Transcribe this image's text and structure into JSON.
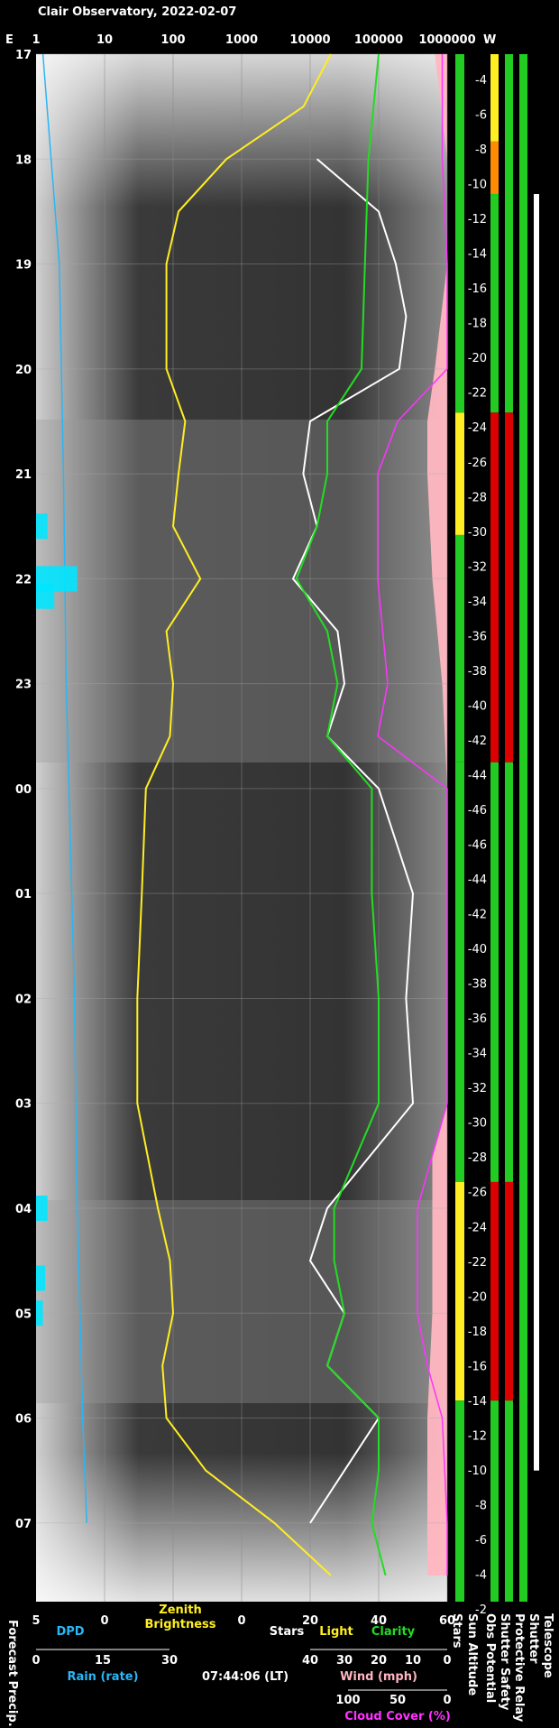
{
  "title": "Clair Observatory, 2022-02-07",
  "timestamp": "07:44:06 (LT)",
  "colors": {
    "dpd": "#29b6f6",
    "zenith": "#ffee22",
    "stars": "#ffffff",
    "light": "#ffee22",
    "clarity": "#22dd22",
    "wind": "#ffb6c1",
    "cloud": "#ff33ff",
    "rain": "#00e5ff",
    "sun": "#ffa500",
    "green": "#22cc22",
    "red": "#dd0000",
    "orange": "#ff8c00",
    "yellow": "#ffee22"
  },
  "top_axis": {
    "left_letter": "E",
    "right_letter": "W",
    "ticks": [
      "1",
      "10",
      "100",
      "1000",
      "10000",
      "100000",
      "1000000"
    ]
  },
  "hours": [
    "17",
    "18",
    "19",
    "20",
    "21",
    "22",
    "23",
    "00",
    "01",
    "02",
    "03",
    "04",
    "05",
    "06",
    "07"
  ],
  "sun_altitude_ticks": [
    "-4",
    "-6",
    "-8",
    "-10",
    "-12",
    "-14",
    "-16",
    "-18",
    "-20",
    "-22",
    "-24",
    "-26",
    "-28",
    "-30",
    "-32",
    "-34",
    "-36",
    "-38",
    "-40",
    "-42",
    "-44",
    "-46",
    "-46",
    "-44",
    "-42",
    "-40",
    "-38",
    "-36",
    "-34",
    "-32",
    "-30",
    "-28",
    "-26",
    "-24",
    "-22",
    "-20",
    "-18",
    "-16",
    "-14",
    "-12",
    "-10",
    "-8",
    "-6",
    "-4",
    "-2"
  ],
  "bottom": {
    "forecast_precip": "Forecast Precip.",
    "dpd_axis": {
      "label": "DPD",
      "ticks": [
        "5",
        "0"
      ]
    },
    "zenith_label_1": "Zenith",
    "zenith_label_2": "Brightness",
    "zenith_ticks": [
      "0"
    ],
    "stars_label": "Stars",
    "light_label": "Light",
    "clarity_label": "Clarity",
    "stars_ticks": [
      "20",
      "40",
      "60"
    ],
    "rain_axis": {
      "label": "Rain (rate)",
      "ticks": [
        "0",
        "15",
        "30"
      ]
    },
    "wind_axis": {
      "label": "Wind (mph)",
      "ticks": [
        "40",
        "30",
        "20",
        "10",
        "0"
      ]
    },
    "cloud_axis": {
      "label": "Cloud Cover (%)",
      "ticks": [
        "100",
        "50",
        "0"
      ]
    },
    "column_labels": [
      "Stars",
      "Sun Altitude",
      "Obs Potential",
      "Shutter Safety",
      "Protective Relay",
      "Shutter",
      "Telescope"
    ]
  },
  "chart_data": {
    "type": "line",
    "title": "Clair Observatory, 2022-02-07",
    "time_range": [
      "17:00",
      "07:45"
    ],
    "x_scale": "log",
    "xlim": [
      1,
      1000000
    ],
    "series": [
      {
        "name": "Zenith Brightness",
        "times": [
          "17:00",
          "17:30",
          "18:00",
          "18:30",
          "19:00",
          "20:00",
          "20:30",
          "21:00",
          "21:30",
          "22:00",
          "22:30",
          "23:00",
          "23:30",
          "00:00",
          "01:00",
          "02:00",
          "03:00",
          "04:00",
          "04:30",
          "05:00",
          "05:30",
          "06:00",
          "06:30",
          "07:00",
          "07:30"
        ],
        "values": [
          20000,
          8000,
          600,
          120,
          80,
          80,
          150,
          120,
          100,
          250,
          80,
          100,
          90,
          40,
          35,
          30,
          30,
          60,
          90,
          100,
          70,
          80,
          300,
          3000,
          20000
        ]
      },
      {
        "name": "Stars",
        "times": [
          "18:00",
          "18:30",
          "19:00",
          "19:30",
          "20:00",
          "20:30",
          "21:00",
          "21:30",
          "22:00",
          "22:30",
          "23:00",
          "23:30",
          "00:00",
          "01:00",
          "02:00",
          "03:00",
          "04:00",
          "04:30",
          "05:00",
          "05:30",
          "06:00",
          "06:30",
          "07:00"
        ],
        "values": [
          22,
          40,
          45,
          48,
          46,
          20,
          18,
          22,
          15,
          28,
          30,
          25,
          40,
          50,
          48,
          50,
          25,
          20,
          30,
          25,
          40,
          30,
          20
        ]
      },
      {
        "name": "Clarity",
        "times": [
          "17:00",
          "18:00",
          "19:00",
          "20:00",
          "20:30",
          "21:00",
          "21:30",
          "22:00",
          "22:30",
          "23:00",
          "23:30",
          "00:00",
          "01:00",
          "02:00",
          "03:00",
          "04:00",
          "04:30",
          "05:00",
          "05:30",
          "06:00",
          "06:30",
          "07:00",
          "07:30"
        ],
        "values": [
          40,
          37,
          36,
          35,
          25,
          25,
          22,
          16,
          25,
          28,
          25,
          38,
          38,
          40,
          40,
          27,
          27,
          30,
          25,
          40,
          40,
          38,
          42
        ]
      },
      {
        "name": "Cloud Cover",
        "times": [
          "17:00",
          "18:00",
          "19:00",
          "20:00",
          "20:30",
          "21:00",
          "22:00",
          "23:00",
          "23:30",
          "00:00",
          "03:00",
          "04:00",
          "05:00",
          "05:30",
          "06:00",
          "07:00",
          "07:30"
        ],
        "values": [
          5,
          5,
          0,
          0,
          50,
          70,
          70,
          60,
          70,
          0,
          0,
          30,
          30,
          20,
          5,
          0,
          0
        ]
      },
      {
        "name": "Wind",
        "times": [
          "17:00",
          "18:00",
          "19:00",
          "20:00",
          "20:30",
          "21:00",
          "22:00",
          "23:00",
          "00:00",
          "01:00",
          "02:00",
          "03:00",
          "03:30",
          "04:00",
          "05:00",
          "06:00",
          "07:00",
          "07:30"
        ],
        "values": [
          5,
          0,
          0,
          5,
          8,
          8,
          6,
          2,
          0,
          0,
          0,
          0,
          6,
          6,
          6,
          8,
          8,
          8
        ]
      },
      {
        "name": "DPD",
        "times": [
          "17:00",
          "19:00",
          "21:00",
          "23:00",
          "00:00",
          "02:00",
          "04:00",
          "06:00",
          "07:00"
        ],
        "values": [
          4.5,
          3.3,
          3.0,
          2.8,
          2.6,
          2.2,
          2.0,
          1.6,
          1.3
        ]
      }
    ],
    "rain_rate": {
      "times": [
        "21:30",
        "22:00",
        "22:10",
        "04:00",
        "04:40",
        "05:00"
      ],
      "values": [
        5,
        18,
        8,
        5,
        4,
        3
      ]
    },
    "sun_altitude": {
      "min": -46,
      "at": "00:45",
      "start": -2,
      "end": -2
    },
    "obs_potential_note": "green clear, red/orange cloudy 20:25–23:45 and 03:45–05:50",
    "legend": "bottom"
  }
}
